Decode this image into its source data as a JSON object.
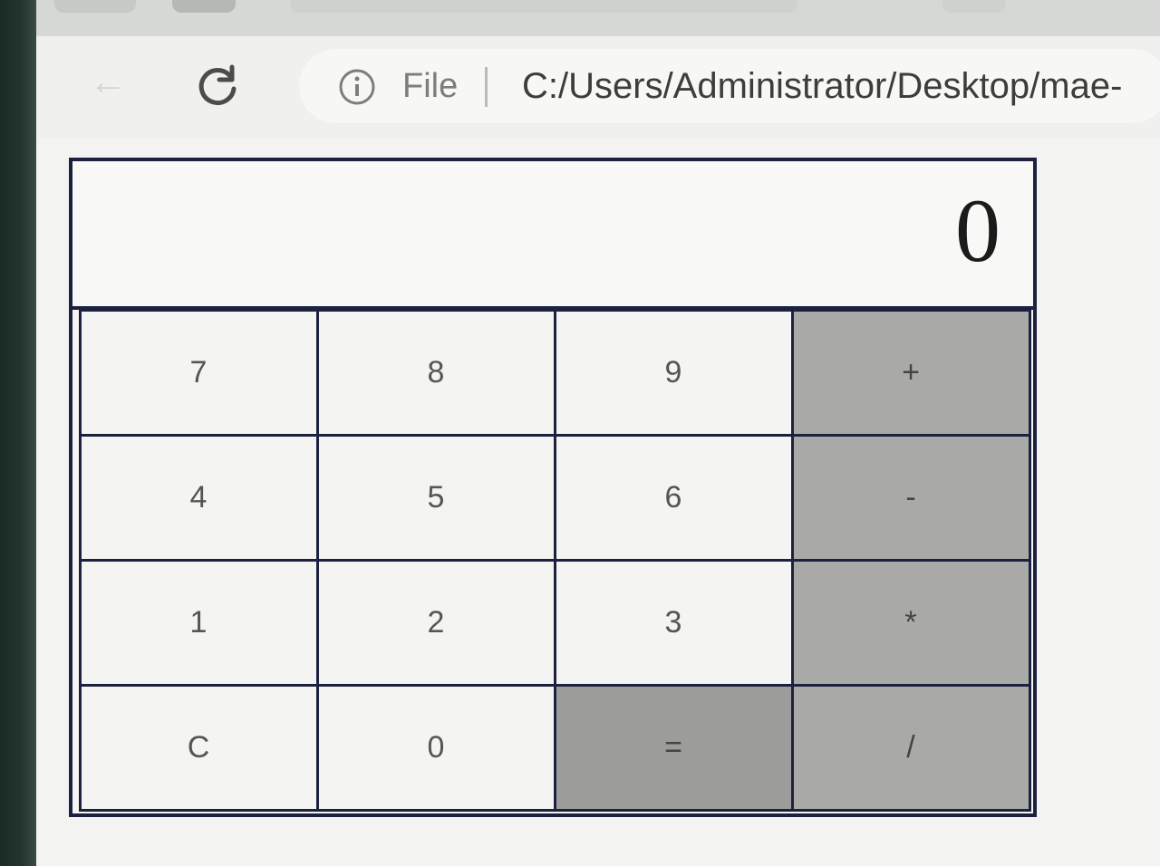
{
  "browser": {
    "scheme_label": "File",
    "url": "C:/Users/Administrator/Desktop/mae-",
    "icons": {
      "back": "back-arrow-icon",
      "reload": "reload-icon",
      "info": "info-icon"
    }
  },
  "calculator": {
    "display_value": "0",
    "keys": [
      {
        "label": "7",
        "kind": "digit"
      },
      {
        "label": "8",
        "kind": "digit"
      },
      {
        "label": "9",
        "kind": "digit"
      },
      {
        "label": "+",
        "kind": "operator"
      },
      {
        "label": "4",
        "kind": "digit"
      },
      {
        "label": "5",
        "kind": "digit"
      },
      {
        "label": "6",
        "kind": "digit"
      },
      {
        "label": "-",
        "kind": "operator"
      },
      {
        "label": "1",
        "kind": "digit"
      },
      {
        "label": "2",
        "kind": "digit"
      },
      {
        "label": "3",
        "kind": "digit"
      },
      {
        "label": "*",
        "kind": "operator"
      },
      {
        "label": "C",
        "kind": "clear"
      },
      {
        "label": "0",
        "kind": "digit"
      },
      {
        "label": "=",
        "kind": "equals"
      },
      {
        "label": "/",
        "kind": "operator"
      }
    ],
    "colors": {
      "border": "#1c2140",
      "operator_bg": "#a9aaa8",
      "equals_bg": "#9c9d9b",
      "key_bg": "#f4f4f2"
    }
  }
}
